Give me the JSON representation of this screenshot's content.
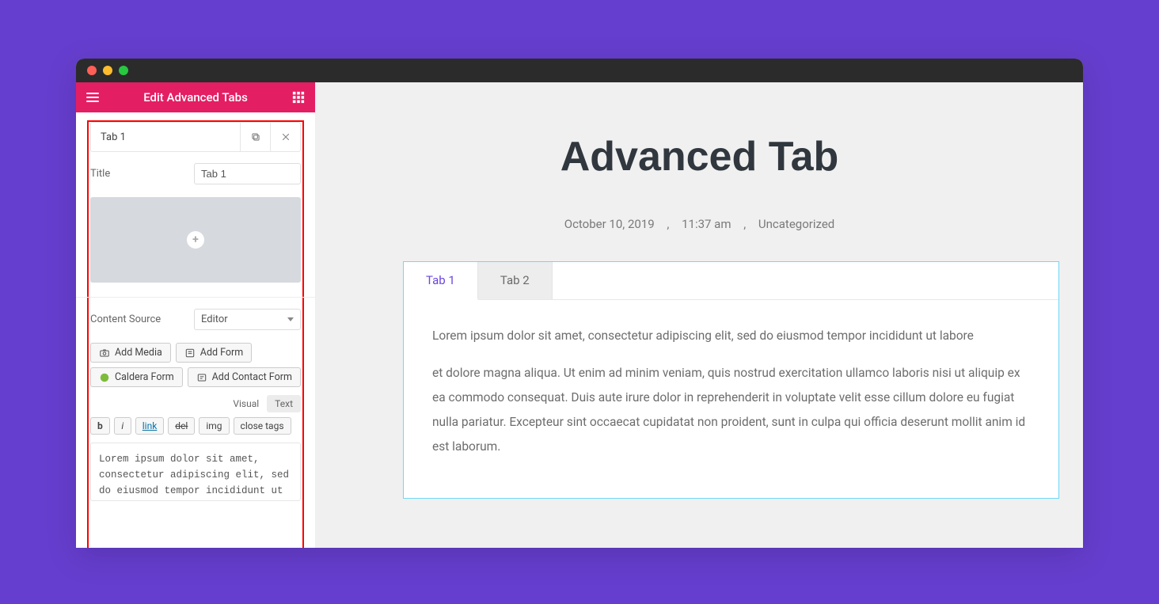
{
  "sidebar": {
    "header_title": "Edit Advanced Tabs",
    "panel_title": "Tab 1",
    "title_label": "Title",
    "title_value": "Tab 1",
    "content_source_label": "Content Source",
    "content_source_value": "Editor",
    "buttons": {
      "add_media": "Add Media",
      "add_form": "Add Form",
      "caldera_form": "Caldera Form",
      "add_contact_form": "Add Contact Form"
    },
    "mode_tabs": {
      "visual": "Visual",
      "text": "Text"
    },
    "format_buttons": {
      "b": "b",
      "i": "i",
      "link": "link",
      "del": "del",
      "img": "img",
      "close_tags": "close tags"
    },
    "textarea_value": "Lorem ipsum dolor sit amet, consectetur adipiscing elit, sed do eiusmod tempor incididunt ut"
  },
  "main": {
    "page_title": "Advanced Tab",
    "meta": {
      "date": "October 10, 2019",
      "time": "11:37 am",
      "category": "Uncategorized"
    },
    "tabs": [
      {
        "label": "Tab 1"
      },
      {
        "label": "Tab 2"
      }
    ],
    "content_p1": "Lorem ipsum dolor sit amet, consectetur adipiscing elit, sed do eiusmod tempor incididunt ut labore",
    "content_p2": "et dolore magna aliqua. Ut enim ad minim veniam, quis nostrud exercitation ullamco laboris nisi ut aliquip ex ea commodo consequat. Duis aute irure dolor in reprehenderit in voluptate velit esse cillum dolore eu fugiat nulla pariatur. Excepteur sint occaecat cupidatat non proident, sunt in culpa qui officia deserunt mollit anim id est laborum."
  }
}
